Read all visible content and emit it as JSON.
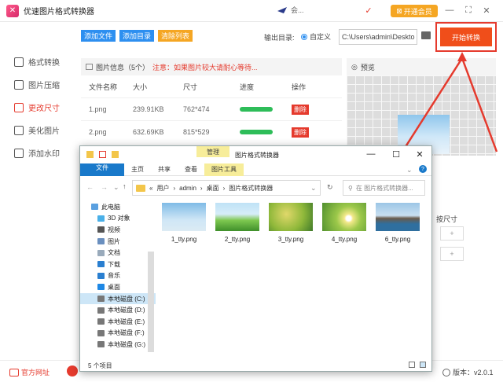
{
  "app": {
    "title": "优速图片格式转换器",
    "logo_glyph": "✕",
    "user_name": "会...",
    "vip_label": "开通会员"
  },
  "titlebar": {
    "pin_icon": "pin-icon",
    "minimize_glyph": "—",
    "fullscreen_glyph": "⛶",
    "close_glyph": "✕"
  },
  "sidebar": {
    "items": [
      {
        "label": "格式转换",
        "icon": "convert-icon",
        "active": false
      },
      {
        "label": "图片压缩",
        "icon": "compress-icon",
        "active": false
      },
      {
        "label": "更改尺寸",
        "icon": "resize-icon",
        "active": true
      },
      {
        "label": "美化图片",
        "icon": "beautify-icon",
        "active": false
      },
      {
        "label": "添加水印",
        "icon": "watermark-icon",
        "active": false
      }
    ]
  },
  "toolbar": {
    "add_file": "添加文件",
    "add_dir": "添加目录",
    "clear_list": "清除列表"
  },
  "output": {
    "label": "输出目录:",
    "radio_label": "自定义",
    "path": "C:\\Users\\admin\\Deskto"
  },
  "start_button": "开始转换",
  "file_list": {
    "header_title": "图片信息（5个）",
    "warning": "注意：如果图片较大请耐心等待...",
    "columns": [
      "文件名称",
      "大小",
      "尺寸",
      "进度",
      "操作"
    ],
    "rows": [
      {
        "name": "1.png",
        "size": "239.91KB",
        "dims": "762*474",
        "delete": "删除"
      },
      {
        "name": "2.png",
        "size": "632.69KB",
        "dims": "815*529",
        "delete": "删除"
      }
    ]
  },
  "preview": {
    "title": "预览"
  },
  "right_panel": {
    "resize_label": "按尺寸"
  },
  "bottom": {
    "website": "官方网址",
    "version": "版本：v2.0.1"
  },
  "explorer": {
    "manage_tab": "管理",
    "window_title": "图片格式转换器",
    "ribbon_tabs": [
      "文件",
      "主页",
      "共享",
      "查看",
      "图片工具"
    ],
    "breadcrumb": [
      "«",
      "用户",
      "›",
      "admin",
      "›",
      "桌面",
      "›",
      "图片格式转换器"
    ],
    "search_placeholder": "在 图片格式转换器...",
    "tree": [
      "此电脑",
      "3D 对象",
      "视频",
      "图片",
      "文档",
      "下载",
      "音乐",
      "桌面",
      "本地磁盘 (C:)",
      "本地磁盘 (D:)",
      "本地磁盘 (E:)",
      "本地磁盘 (F:)",
      "本地磁盘 (G:)"
    ],
    "files": [
      "1_tty.png",
      "2_tty.png",
      "3_tty.png",
      "4_tty.png",
      "6_tty.png"
    ],
    "status": "5 个项目"
  },
  "colors": {
    "accent_red": "#e53a2d",
    "blue": "#2d8ff0",
    "orange": "#f5a623",
    "progress_green": "#2ebd59",
    "explorer_file_tab": "#1979ca",
    "explorer_tools_tab": "#f7ed9a"
  }
}
